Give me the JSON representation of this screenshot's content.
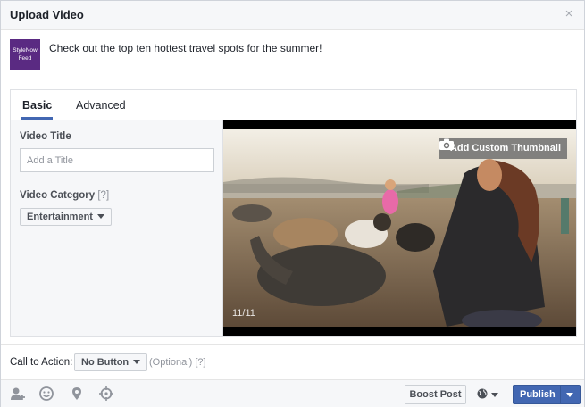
{
  "dialog": {
    "title": "Upload Video",
    "close_glyph": "×"
  },
  "composer": {
    "page_avatar_line1": "StyleNow",
    "page_avatar_line2": "Feed",
    "status_text": "Check out the top ten hottest travel spots for the summer!"
  },
  "tabs": {
    "basic": "Basic",
    "advanced": "Advanced"
  },
  "basic": {
    "video_title_label": "Video Title",
    "video_title_placeholder": "Add a Title",
    "video_category_label": "Video Category",
    "video_category_hint": "[?]",
    "video_category_value": "Entertainment"
  },
  "video": {
    "thumbnail_button": "Add Custom Thumbnail",
    "frame_counter": "11/11"
  },
  "cta": {
    "label": "Call to Action:",
    "value": "No Button",
    "optional": "(Optional)",
    "hint": "[?]"
  },
  "footer": {
    "boost_label": "Boost Post",
    "publish_label": "Publish",
    "icons": [
      "tag-people-icon",
      "feeling-icon",
      "location-icon",
      "target-icon",
      "globe-icon"
    ]
  },
  "colors": {
    "accent": "#4267b2",
    "brand_avatar": "#5a2a82",
    "header_bg": "#f6f7f9"
  }
}
